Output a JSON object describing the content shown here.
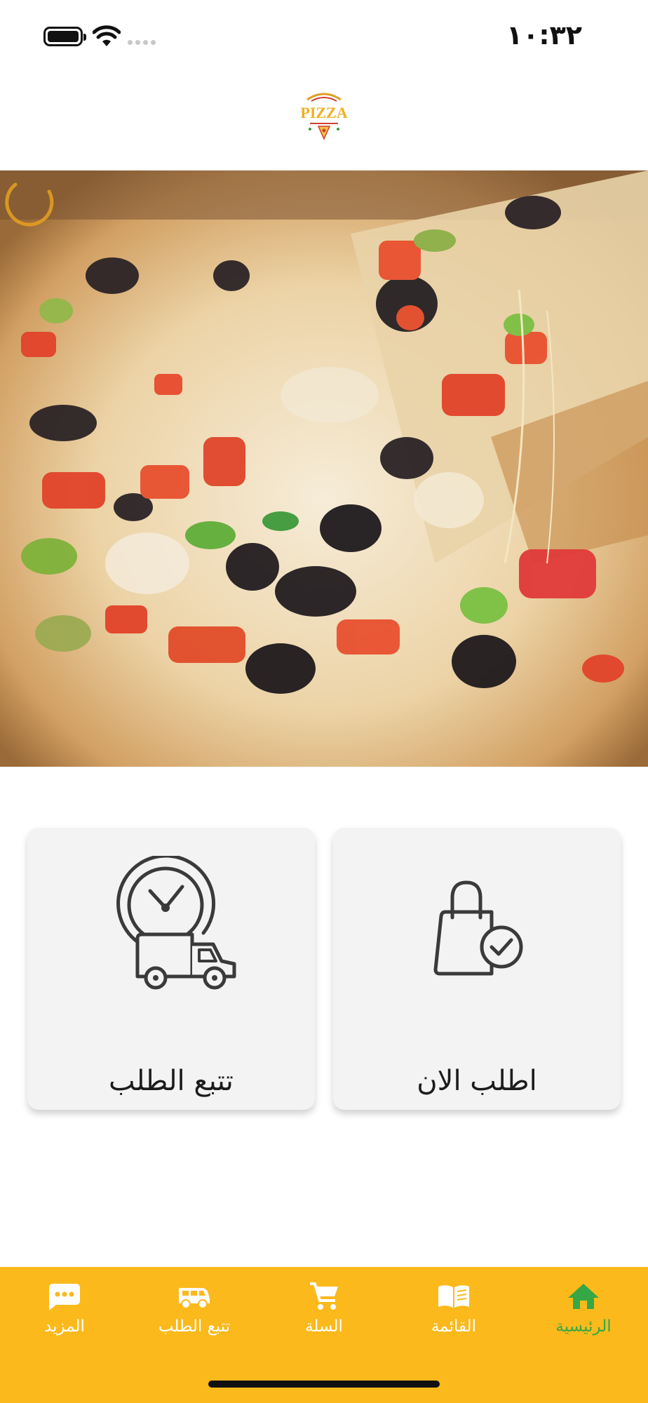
{
  "status_bar": {
    "time": "١٠:٣٢",
    "icons": [
      "battery-icon",
      "wifi-icon",
      "signal-icon"
    ]
  },
  "header": {
    "logo_text": "PIZZA"
  },
  "banner": {
    "image": "pizza-photo",
    "active_slide": 1,
    "slide_count": 1
  },
  "actions": {
    "order_now": {
      "label": "اطلب الان",
      "icon": "shopping-bag-check-icon"
    },
    "track_order": {
      "label": "تتبع الطلب",
      "icon": "clock-delivery-truck-icon"
    }
  },
  "bottom_nav": {
    "items": [
      {
        "label": "الرئيسية",
        "icon": "home-icon",
        "active": true
      },
      {
        "label": "القائمة",
        "icon": "menu-book-icon",
        "active": false
      },
      {
        "label": "السلة",
        "icon": "cart-icon",
        "active": false
      },
      {
        "label": "تتبع الطلب",
        "icon": "delivery-van-icon",
        "active": false
      },
      {
        "label": "المزيد",
        "icon": "more-chat-icon",
        "active": false
      }
    ]
  },
  "colors": {
    "nav_background": "#fbb91c",
    "nav_active": "#35a845",
    "nav_inactive": "#ffffff",
    "accent": "#f5a214",
    "card_background": "#f3f3f3"
  }
}
